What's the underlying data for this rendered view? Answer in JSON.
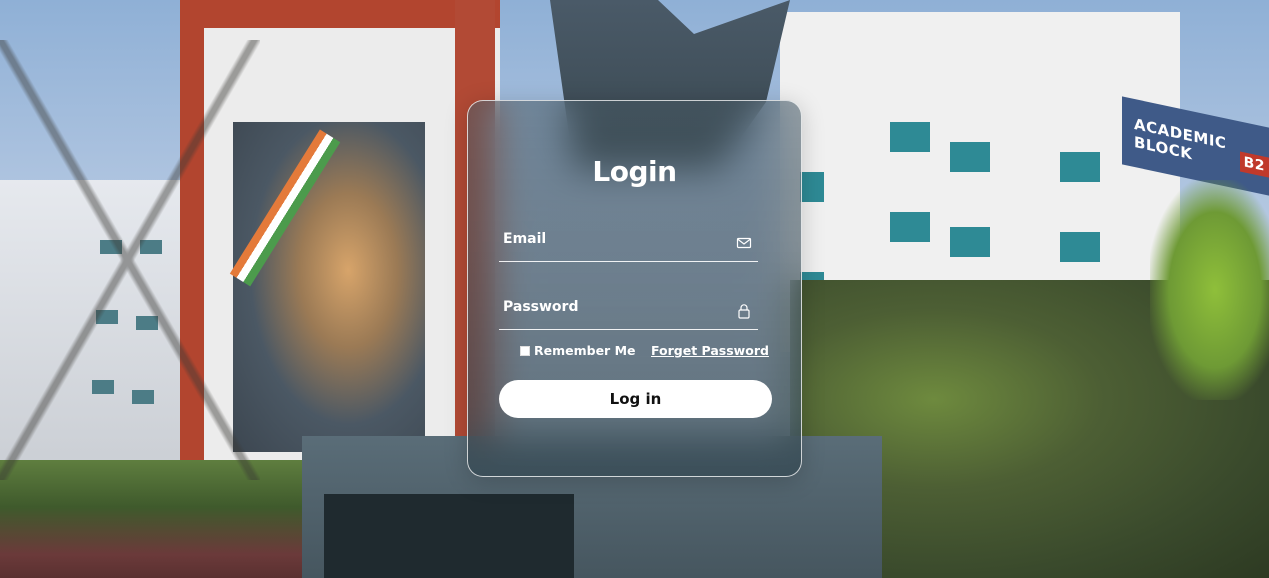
{
  "login": {
    "title": "Login",
    "email_label": "Email",
    "password_label": "Password",
    "remember_label": "Remember Me",
    "forgot_label": "Forget Password",
    "submit_label": "Log in"
  },
  "background": {
    "sign_text": "ACADEMIC BLOCK",
    "sign_block": "B2"
  },
  "colors": {
    "card_border": "#ffffff",
    "button_bg": "#ffffff",
    "button_text": "#111111"
  },
  "icons": {
    "email": "mail-icon",
    "password": "lock-icon"
  }
}
